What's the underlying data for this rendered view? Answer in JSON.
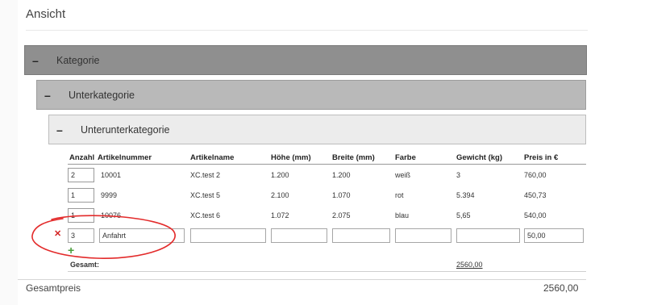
{
  "page_title": "Ansicht",
  "categories": {
    "level1": "Kategorie",
    "level2": "Unterkategorie",
    "level3": "Unterunterkategorie"
  },
  "table": {
    "headers": [
      "Anzahl",
      "Artikelnummer",
      "Artikelname",
      "Höhe (mm)",
      "Breite (mm)",
      "Farbe",
      "Gewicht (kg)",
      "Preis in €"
    ],
    "rows": [
      {
        "anzahl": "2",
        "artikelnummer": "10001",
        "artikelname": "XC.test 2",
        "hoehe": "1.200",
        "breite": "1.200",
        "farbe": "weiß",
        "gewicht": "3",
        "preis": "760,00"
      },
      {
        "anzahl": "1",
        "artikelnummer": "9999",
        "artikelname": "XC.test 5",
        "hoehe": "2.100",
        "breite": "1.070",
        "farbe": "rot",
        "gewicht": "5.394",
        "preis": "450,73"
      },
      {
        "anzahl": "1",
        "artikelnummer": "10076",
        "artikelname": "XC.test 6",
        "hoehe": "1.072",
        "breite": "2.075",
        "farbe": "blau",
        "gewicht": "5,65",
        "preis": "540,00"
      }
    ],
    "edit_row": {
      "anzahl": "3",
      "artikelnummer": "Anfahrt",
      "artikelname": "",
      "hoehe": "",
      "breite": "",
      "farbe": "",
      "gewicht": "",
      "preis": "50,00"
    },
    "delete_icon": "close-icon",
    "add_icon": "plus-icon",
    "gesamt_label": "Gesamt:",
    "gesamt_value": "2560,00"
  },
  "footer": {
    "total_label": "Gesamtpreis",
    "total_value": "2560,00"
  },
  "colors": {
    "level1_bg": "#8f8f8f",
    "level2_bg": "#b9b9b9",
    "level3_bg": "#ececec",
    "delete": "#d32222",
    "add": "#4a9e3b",
    "annotation": "#e32b2b"
  }
}
